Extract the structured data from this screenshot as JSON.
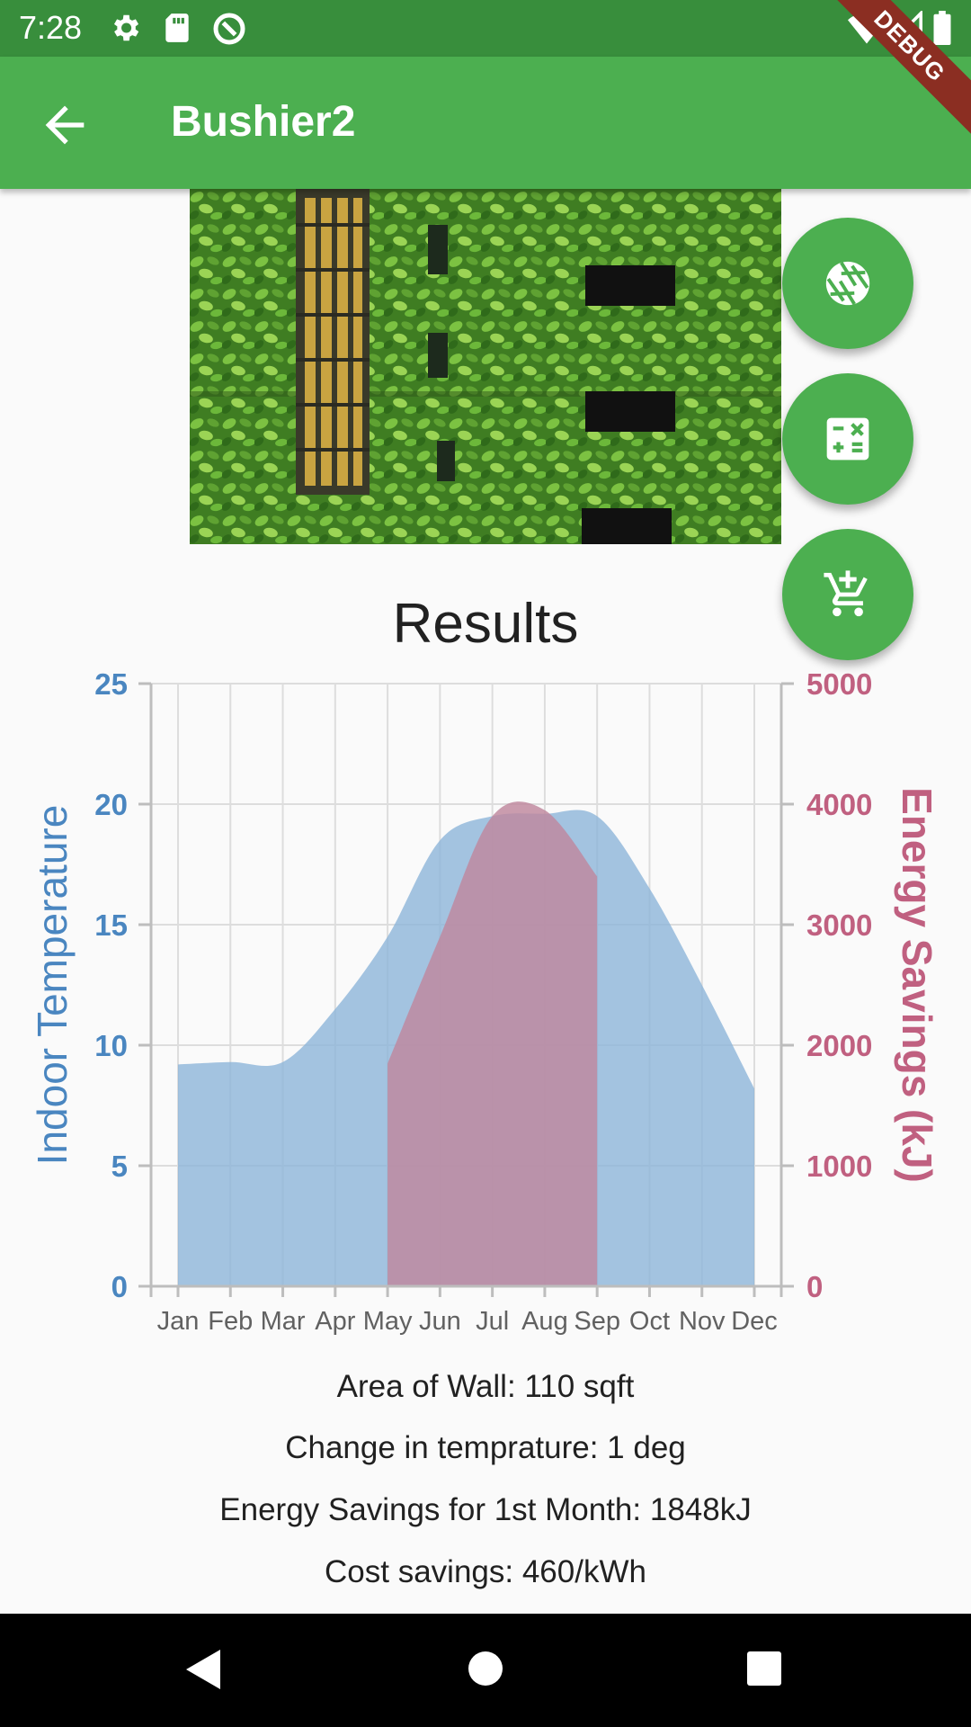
{
  "status_bar": {
    "time": "7:28",
    "icons": [
      "settings-icon",
      "sd-card-icon",
      "sync-icon",
      "wifi-icon",
      "signal-icon",
      "battery-icon"
    ]
  },
  "app_bar": {
    "title": "Bushier2",
    "debug_label": "DEBUG",
    "color": "#4caf50",
    "status_color": "#388e3c"
  },
  "fab_buttons": [
    {
      "icon": "camera-shutter-icon"
    },
    {
      "icon": "calculator-icon"
    },
    {
      "icon": "add-to-cart-icon"
    }
  ],
  "results": {
    "title": "Results",
    "area": "Area of Wall: 110 sqft",
    "temp_change": "Change in temprature: 1 deg",
    "energy_first_month": "Energy Savings for 1st Month: 1848kJ",
    "cost_savings": "Cost savings: 460/kWh"
  },
  "chart_data": {
    "type": "area",
    "categories": [
      "Jan",
      "Feb",
      "Mar",
      "Apr",
      "May",
      "Jun",
      "Jul",
      "Aug",
      "Sep",
      "Oct",
      "Nov",
      "Dec"
    ],
    "left_axis": {
      "label": "Indoor Temperature",
      "min": 0,
      "max": 25,
      "ticks": [
        "0",
        "5",
        "10",
        "15",
        "20",
        "25"
      ],
      "color": "#4a86c0"
    },
    "right_axis": {
      "label": "Energy Savings (kJ)",
      "min": 0,
      "max": 5000,
      "ticks": [
        "0",
        "1000",
        "2000",
        "3000",
        "4000",
        "5000"
      ],
      "color": "#c06080"
    },
    "series": [
      {
        "axis": "left",
        "values": [
          9.2,
          9.3,
          9.3,
          11.5,
          14.5,
          18.5,
          19.5,
          19.6,
          19.5,
          16.5,
          12.5,
          8.2
        ],
        "color": "#8ab4d8"
      },
      {
        "axis": "right",
        "x_range": [
          "May",
          "Sep"
        ],
        "values": [
          null,
          null,
          null,
          null,
          1848,
          2900,
          3900,
          3950,
          3400,
          null,
          null,
          null
        ],
        "color": "#c0889e"
      }
    ],
    "grid": true
  }
}
